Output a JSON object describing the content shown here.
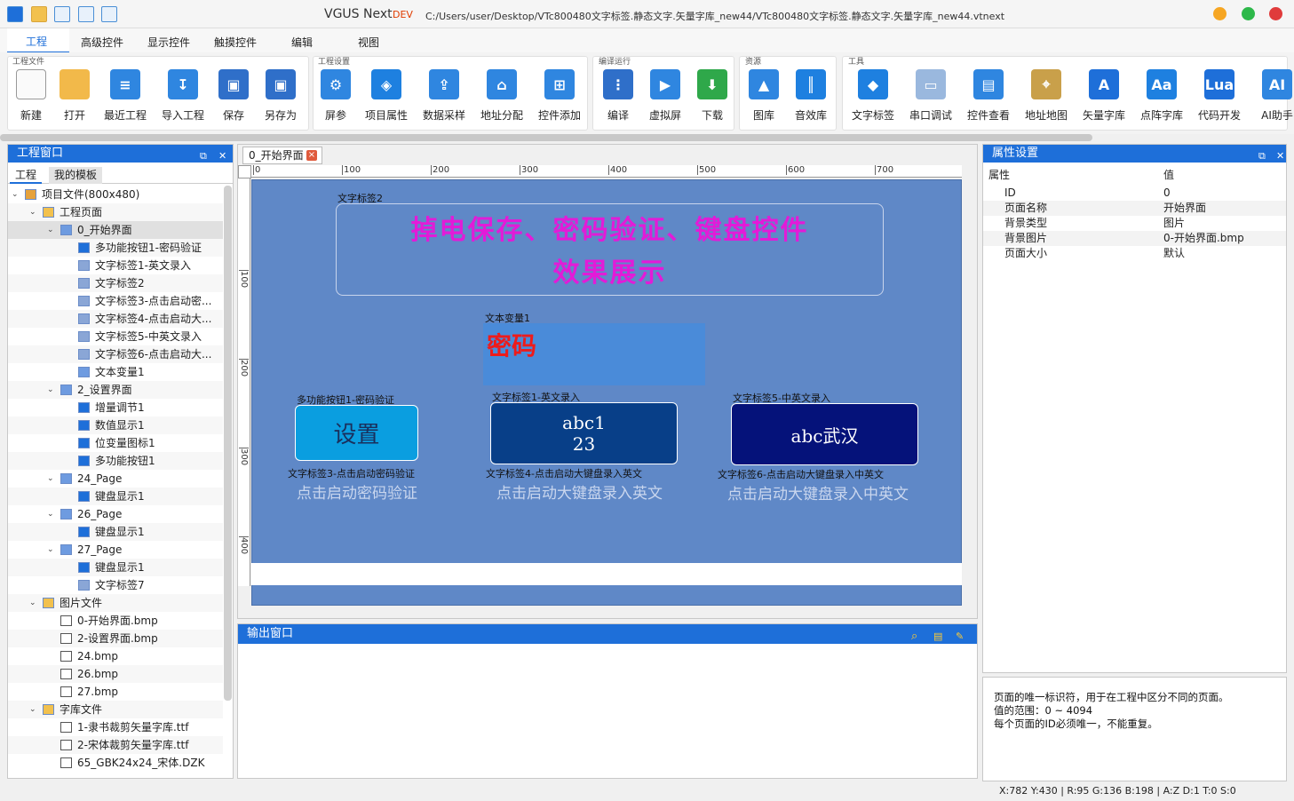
{
  "titlebar": {
    "app_name": "VGUS Next",
    "dev_badge": "DEV",
    "path": "C:/Users/user/Desktop/VTc800480文字标签.静态文字.矢量字库_new44/VTc800480文字标签.静态文字.矢量字库_new44.vtnext"
  },
  "menu": {
    "tabs": [
      "工程",
      "高级控件",
      "显示控件",
      "触摸控件",
      "编辑",
      "视图"
    ]
  },
  "ribbon": {
    "groups": [
      "工程文件",
      "工程设置",
      "编译运行",
      "资源",
      "工具"
    ],
    "buttons": [
      "新建",
      "打开",
      "最近工程",
      "导入工程",
      "保存",
      "另存为",
      "屏参",
      "项目属性",
      "数据采样",
      "地址分配",
      "控件添加",
      "编译",
      "虚拟屏",
      "下载",
      "图库",
      "音效库",
      "文字标签",
      "串口调试",
      "控件查看",
      "地址地图",
      "矢量字库",
      "点阵字库",
      "代码开发",
      "AI助手"
    ],
    "icon_names": [
      "new-file-icon",
      "open-folder-icon",
      "recent-project-icon",
      "import-project-icon",
      "save-icon",
      "save-as-icon",
      "screen-params-icon",
      "project-props-icon",
      "data-sampling-icon",
      "address-assign-icon",
      "add-control-icon",
      "compile-icon",
      "virtual-screen-icon",
      "download-icon",
      "gallery-icon",
      "sound-library-icon",
      "text-label-icon",
      "serial-debug-icon",
      "control-view-icon",
      "address-map-icon",
      "vector-font-icon",
      "bitmap-font-icon",
      "code-dev-icon",
      "ai-assistant-icon"
    ]
  },
  "left_panel": {
    "title": "工程窗口",
    "tabs": [
      "工程",
      "我的模板"
    ],
    "tree": [
      {
        "label": "项目文件(800x480)",
        "level": 0,
        "icon": "project-icon"
      },
      {
        "label": "工程页面",
        "level": 1,
        "icon": "folder-icon"
      },
      {
        "label": "0_开始界面",
        "level": 2,
        "icon": "page-icon"
      },
      {
        "label": "多功能按钮1-密码验证",
        "level": 3,
        "icon": "button-icon"
      },
      {
        "label": "文字标签1-英文录入",
        "level": 3,
        "icon": "text-icon"
      },
      {
        "label": "文字标签2",
        "level": 3,
        "icon": "text-icon"
      },
      {
        "label": "文字标签3-点击启动密...",
        "level": 3,
        "icon": "text-icon"
      },
      {
        "label": "文字标签4-点击启动大...",
        "level": 3,
        "icon": "text-icon"
      },
      {
        "label": "文字标签5-中英文录入",
        "level": 3,
        "icon": "text-icon"
      },
      {
        "label": "文字标签6-点击启动大...",
        "level": 3,
        "icon": "text-icon"
      },
      {
        "label": "文本变量1",
        "level": 3,
        "icon": "textvar-icon"
      },
      {
        "label": "2_设置界面",
        "level": 2,
        "icon": "page-icon"
      },
      {
        "label": "增量调节1",
        "level": 3,
        "icon": "increment-icon"
      },
      {
        "label": "数值显示1",
        "level": 3,
        "icon": "number-icon"
      },
      {
        "label": "位变量图标1",
        "level": 3,
        "icon": "bitvar-icon"
      },
      {
        "label": "多功能按钮1",
        "level": 3,
        "icon": "button-icon"
      },
      {
        "label": "24_Page",
        "level": 2,
        "icon": "page-icon"
      },
      {
        "label": "键盘显示1",
        "level": 3,
        "icon": "keyboard-icon"
      },
      {
        "label": "26_Page",
        "level": 2,
        "icon": "page-icon"
      },
      {
        "label": "键盘显示1",
        "level": 3,
        "icon": "keyboard-icon"
      },
      {
        "label": "27_Page",
        "level": 2,
        "icon": "page-icon"
      },
      {
        "label": "键盘显示1",
        "level": 3,
        "icon": "keyboard-icon"
      },
      {
        "label": "文字标签7",
        "level": 3,
        "icon": "text-icon"
      },
      {
        "label": "图片文件",
        "level": 1,
        "icon": "folder-icon"
      },
      {
        "label": "0-开始界面.bmp",
        "level": 2,
        "icon": "file-icon"
      },
      {
        "label": "2-设置界面.bmp",
        "level": 2,
        "icon": "file-icon"
      },
      {
        "label": "24.bmp",
        "level": 2,
        "icon": "file-icon"
      },
      {
        "label": "26.bmp",
        "level": 2,
        "icon": "file-icon"
      },
      {
        "label": "27.bmp",
        "level": 2,
        "icon": "file-icon"
      },
      {
        "label": "字库文件",
        "level": 1,
        "icon": "folder-icon"
      },
      {
        "label": "1-隶书裁剪矢量字库.ttf",
        "level": 2,
        "icon": "font-file-icon"
      },
      {
        "label": "2-宋体裁剪矢量字库.ttf",
        "level": 2,
        "icon": "font-file-icon"
      },
      {
        "label": "65_GBK24x24_宋体.DZK",
        "level": 2,
        "icon": "font-file-icon"
      }
    ]
  },
  "editor": {
    "doc_tab": "0_开始界面",
    "ruler_top": [
      "0",
      "100",
      "200",
      "300",
      "400",
      "500",
      "600",
      "700"
    ],
    "ruler_left": [
      "100",
      "200",
      "300",
      "400"
    ],
    "widgets": {
      "title_caption": "文字标签2",
      "title_line1": "掉电保存、密码验证、键盘控件",
      "title_line2": "效果展示",
      "var_caption": "文本变量1",
      "var_text": "密码",
      "btn1_caption": "多功能按钮1-密码验证",
      "btn1_text": "设置",
      "btn2_caption": "文字标签1-英文录入",
      "btn2_line1": "abc1",
      "btn2_line2": "23",
      "btn3_caption": "文字标签5-中英文录入",
      "btn3_text": "abc武汉",
      "hint1_caption": "文字标签3-点击启动密码验证",
      "hint1_text": "点击启动密码验证",
      "hint2_caption": "文字标签4-点击启动大键盘录入英文",
      "hint2_text": "点击启动大键盘录入英文",
      "hint3_caption": "文字标签6-点击启动大键盘录入中英文",
      "hint3_text": "点击启动大键盘录入中英文"
    }
  },
  "output": {
    "title": "输出窗口"
  },
  "properties": {
    "title": "属性设置",
    "col_key": "属性",
    "col_val": "值",
    "rows": [
      {
        "k": "ID",
        "v": "0"
      },
      {
        "k": "页面名称",
        "v": "开始界面"
      },
      {
        "k": "背景类型",
        "v": "图片"
      },
      {
        "k": "背景图片",
        "v": "0-开始界面.bmp"
      },
      {
        "k": "页面大小",
        "v": "默认"
      }
    ],
    "description": [
      "页面的唯一标识符，用于在工程中区分不同的页面。",
      "值的范围：0 ~ 4094",
      "每个页面的ID必须唯一，不能重复。"
    ]
  },
  "status": {
    "text": "X:782  Y:430  |  R:95 G:136 B:198  |  A:Z  D:1  T:0  S:0"
  },
  "colors": {
    "accent": "#1e6fd9",
    "page_bg": "#5f88c7",
    "title_magenta": "#e21bd8",
    "var_red": "#ee1b1b",
    "btn1": "#0a9ee0",
    "btn2": "#083f88",
    "btn3": "#05127a"
  }
}
